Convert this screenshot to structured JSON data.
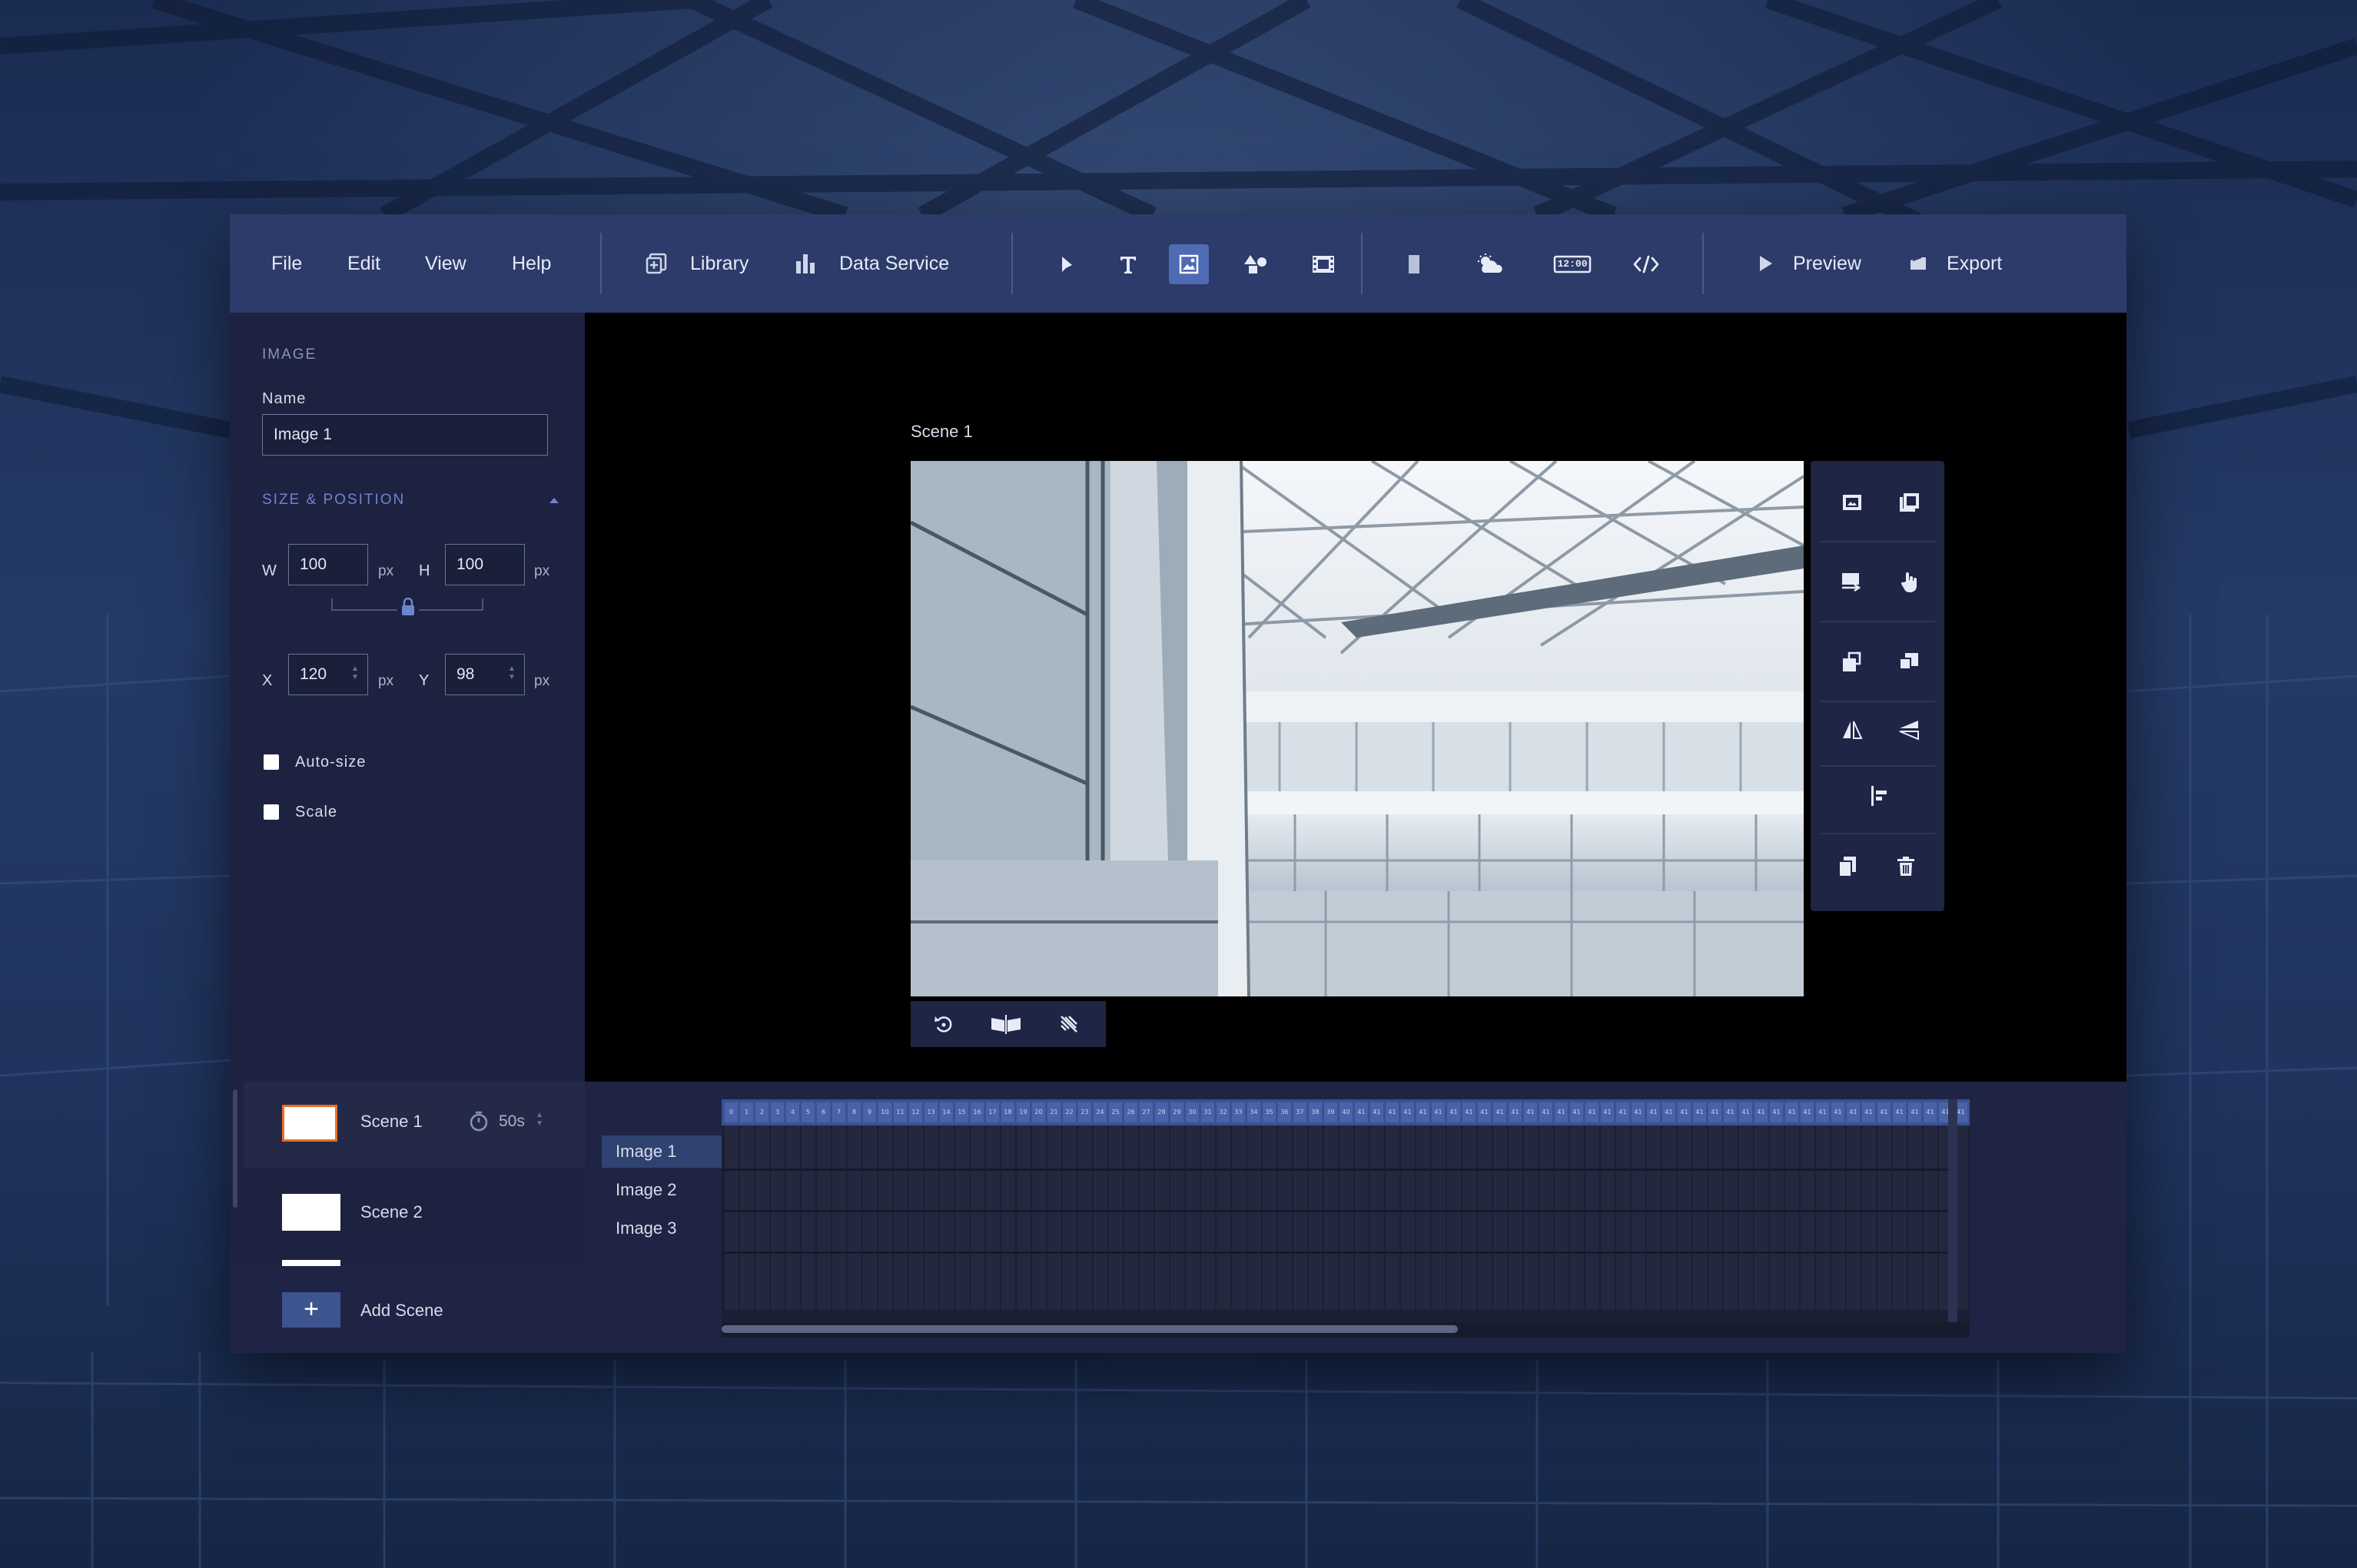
{
  "menu": {
    "items": [
      "File",
      "Edit",
      "View",
      "Help"
    ],
    "library_label": "Library",
    "data_service_label": "Data Service",
    "preview_label": "Preview",
    "export_label": "Export",
    "clock_label": "12:00"
  },
  "tools": [
    "select-tool",
    "text-tool",
    "image-tool",
    "shapes-tool",
    "video-tool",
    "rectangle-tool",
    "weather-tool",
    "clock-tool",
    "code-tool"
  ],
  "active_tool": "image-tool",
  "properties": {
    "section_title": "IMAGE",
    "name_label": "Name",
    "name_value": "Image 1",
    "size_position_title": "SIZE & POSITION",
    "w_label": "W",
    "w_value": "100",
    "h_label": "H",
    "h_value": "100",
    "x_label": "X",
    "x_value": "120",
    "y_label": "Y",
    "y_value": "98",
    "unit": "px",
    "auto_size_label": "Auto-size",
    "scale_label": "Scale"
  },
  "canvas": {
    "scene_title": "Scene 1"
  },
  "scenes": {
    "items": [
      {
        "name": "Scene 1",
        "duration": "50s"
      },
      {
        "name": "Scene 2"
      }
    ],
    "add_label": "Add Scene"
  },
  "layers": [
    {
      "name": "Image 1",
      "locked": false,
      "visible": true
    },
    {
      "name": "Image 2",
      "locked": true,
      "visible": true
    },
    {
      "name": "Image 3",
      "locked": false,
      "visible": false
    }
  ],
  "timeline": {
    "frame_numbers": [
      "0",
      "1",
      "2",
      "3",
      "4",
      "5",
      "6",
      "7",
      "8",
      "9",
      "10",
      "11",
      "12",
      "13",
      "14",
      "15",
      "16",
      "17",
      "18",
      "19",
      "20",
      "21",
      "22",
      "23",
      "24",
      "25",
      "26",
      "27",
      "28",
      "29",
      "30",
      "31",
      "32",
      "33",
      "34",
      "35",
      "36",
      "37",
      "38",
      "39",
      "40",
      "41",
      "41",
      "41",
      "41",
      "41",
      "41",
      "41",
      "41",
      "41",
      "41",
      "41",
      "41",
      "41",
      "41",
      "41",
      "41",
      "41",
      "41",
      "41",
      "41",
      "41",
      "41",
      "41",
      "41",
      "41",
      "41",
      "41",
      "41",
      "41",
      "41",
      "41",
      "41",
      "41",
      "41",
      "41",
      "41",
      "41",
      "41",
      "41",
      "41",
      "41",
      "41"
    ],
    "scroll_fraction": 0.59
  },
  "colors": {
    "menubar": "#2c3b69",
    "panel": "#1d2240",
    "accent": "#4f6bb3",
    "scene_selected_border": "#e8702a"
  }
}
